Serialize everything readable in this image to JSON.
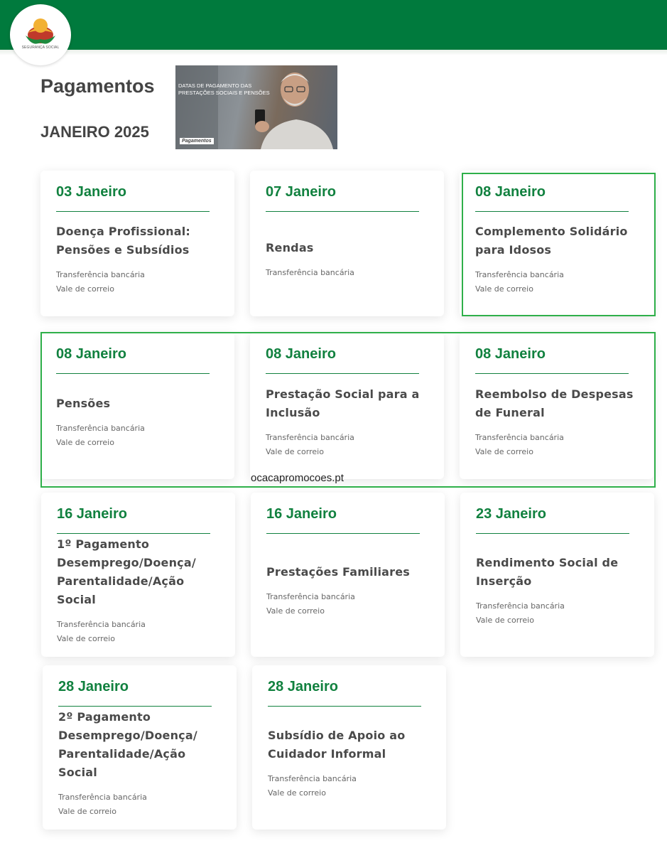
{
  "header": {
    "brand": "SEGURANÇA SOCIAL",
    "brand_color": "#007a3d",
    "page_title": "Pagamentos",
    "month": "JANEIRO 2025",
    "banner_caption": "DATAS DE PAGAMENTO DAS PRESTAÇÕES SOCIAIS E PENSÕES",
    "banner_tag": "Pagamentos"
  },
  "colors": {
    "date_green": "#11813f",
    "highlight_outline": "#2fb04a"
  },
  "cards": [
    {
      "date": "03 Janeiro",
      "service": "Doença Profissional: Pensões e Subsídios",
      "methods": [
        "Transferência bancária",
        "Vale de correio"
      ]
    },
    {
      "date": "07 Janeiro",
      "service": "Rendas",
      "methods": [
        "Transferência bancária"
      ]
    },
    {
      "date": "08 Janeiro",
      "service": "Complemento Solidário para Idosos",
      "methods": [
        "Transferência bancária",
        "Vale de correio"
      ]
    },
    {
      "date": "08 Janeiro",
      "service": "Pensões",
      "methods": [
        "Transferência bancária",
        "Vale de correio"
      ]
    },
    {
      "date": "08 Janeiro",
      "service": "Prestação Social para a Inclusão",
      "methods": [
        "Transferência bancária",
        "Vale de correio"
      ]
    },
    {
      "date": "08 Janeiro",
      "service": "Reembolso de Despesas de Funeral",
      "methods": [
        "Transferência bancária",
        "Vale de correio"
      ]
    },
    {
      "date": "16 Janeiro",
      "service": "1º Pagamento Desemprego/Doença/ Parentalidade/Ação Social",
      "methods": [
        "Transferência bancária",
        "Vale de correio"
      ]
    },
    {
      "date": "16 Janeiro",
      "service": "Prestações Familiares",
      "methods": [
        "Transferência bancária",
        "Vale de correio"
      ]
    },
    {
      "date": "23 Janeiro",
      "service": "Rendimento Social de Inserção",
      "methods": [
        "Transferência bancária",
        "Vale de correio"
      ]
    },
    {
      "date": "28 Janeiro",
      "service": "2º Pagamento Desemprego/Doença/ Parentalidade/Ação Social",
      "methods": [
        "Transferência bancária",
        "Vale de correio"
      ]
    },
    {
      "date": "28 Janeiro",
      "service": "Subsídio de Apoio ao Cuidador Informal",
      "methods": [
        "Transferência bancária",
        "Vale de correio"
      ]
    }
  ],
  "watermark": "ocacapromocoes.pt"
}
